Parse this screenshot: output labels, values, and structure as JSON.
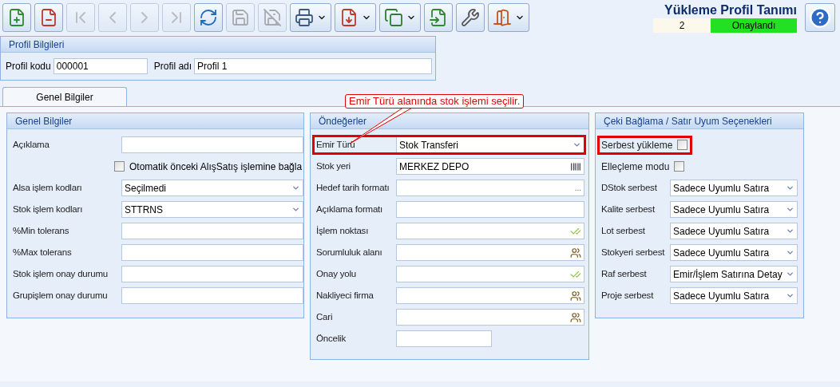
{
  "toolbar": [
    {
      "kind": "new",
      "disabled": false,
      "dropdown": false
    },
    {
      "kind": "delete",
      "disabled": false,
      "dropdown": false
    },
    {
      "kind": "first",
      "disabled": true,
      "dropdown": false
    },
    {
      "kind": "prev",
      "disabled": true,
      "dropdown": false
    },
    {
      "kind": "next",
      "disabled": true,
      "dropdown": false
    },
    {
      "kind": "last",
      "disabled": true,
      "dropdown": false
    },
    {
      "kind": "refresh",
      "disabled": false,
      "dropdown": false
    },
    {
      "kind": "save",
      "disabled": true,
      "dropdown": false
    },
    {
      "kind": "save-close",
      "disabled": true,
      "dropdown": false
    },
    {
      "kind": "print",
      "disabled": false,
      "dropdown": true
    },
    {
      "kind": "pdf",
      "disabled": false,
      "dropdown": true
    },
    {
      "kind": "copy",
      "disabled": false,
      "dropdown": true
    },
    {
      "kind": "import",
      "disabled": false,
      "dropdown": false
    },
    {
      "kind": "tools",
      "disabled": false,
      "dropdown": false
    },
    {
      "kind": "exit",
      "disabled": false,
      "dropdown": true
    }
  ],
  "window": {
    "title": "Yükleme Profil Tanımı",
    "number": "2",
    "status": "Onaylandı"
  },
  "profile": {
    "title": "Profil Bilgileri",
    "code_label": "Profil kodu",
    "code": "000001",
    "name_label": "Profil adı",
    "name": "Profil 1"
  },
  "tabs": [
    {
      "label": "Genel Bilgiler",
      "selected": true
    }
  ],
  "callout": {
    "text": "Emir Türü alanında stok işlemi seçilir."
  },
  "panels": [
    {
      "title": "Genel Bilgiler",
      "rows": [
        {
          "kind": "text",
          "label": "Açıklama",
          "highlighted": false
        },
        {
          "kind": "check",
          "label": "Otomatik önceki AlışSatış işlemine bağla",
          "checked": false,
          "highlighted": false
        },
        {
          "kind": "combo",
          "label": "Alsa işlem kodları",
          "value": "Seçilmedi",
          "highlighted": false
        },
        {
          "kind": "combo",
          "label": "Stok işlem kodları",
          "value": "STTRNS",
          "highlighted": false
        },
        {
          "kind": "text",
          "label": "%Min tolerans",
          "highlighted": false
        },
        {
          "kind": "text",
          "label": "%Max tolerans",
          "highlighted": false
        },
        {
          "kind": "text",
          "label": "Stok işlem onay durumu",
          "highlighted": false
        },
        {
          "kind": "text",
          "label": "Grupişlem onay durumu",
          "highlighted": false
        }
      ]
    },
    {
      "title": "Öndeğerler",
      "rows": [
        {
          "kind": "combo",
          "label": "Emir Türü",
          "value": "Stok Transferi",
          "highlighted": true
        },
        {
          "kind": "barcode",
          "label": "Stok yeri",
          "value": "MERKEZ DEPO",
          "highlighted": false
        },
        {
          "kind": "ellipsis",
          "label": "Hedef tarih formatı",
          "button": "...",
          "highlighted": false
        },
        {
          "kind": "text",
          "label": "Açıklama formatı",
          "highlighted": false
        },
        {
          "kind": "verify",
          "label": "İşlem noktası",
          "highlighted": false
        },
        {
          "kind": "people",
          "label": "Sorumluluk alanı",
          "highlighted": false
        },
        {
          "kind": "verify",
          "label": "Onay yolu",
          "highlighted": false
        },
        {
          "kind": "people",
          "label": "Nakliyeci firma",
          "highlighted": false
        },
        {
          "kind": "people",
          "label": "Cari",
          "highlighted": false
        },
        {
          "kind": "short",
          "label": "Öncelik",
          "highlighted": false
        }
      ]
    },
    {
      "title": "Çeki Bağlama / Satır Uyum Seçenekleri",
      "rows": [
        {
          "kind": "checkright",
          "label": "Serbest yükleme",
          "checked": false,
          "highlighted": true
        },
        {
          "kind": "checkright",
          "label": "Elleçleme modu",
          "checked": false,
          "highlighted": false
        },
        {
          "kind": "combo",
          "label": "DStok serbest",
          "value": "Sadece Uyumlu Satıra",
          "highlighted": false
        },
        {
          "kind": "combo",
          "label": "Kalite serbest",
          "value": "Sadece Uyumlu Satıra",
          "highlighted": false
        },
        {
          "kind": "combo",
          "label": "Lot serbest",
          "value": "Sadece Uyumlu Satıra",
          "highlighted": false
        },
        {
          "kind": "combo",
          "label": "Stokyeri serbest",
          "value": "Sadece Uyumlu Satıra",
          "highlighted": false
        },
        {
          "kind": "combo",
          "label": "Raf serbest",
          "value": "Emir/İşlem Satırına Detay",
          "highlighted": false
        },
        {
          "kind": "combo",
          "label": "Proje serbest",
          "value": "Sadece Uyumlu Satıra",
          "highlighted": false
        }
      ]
    }
  ]
}
